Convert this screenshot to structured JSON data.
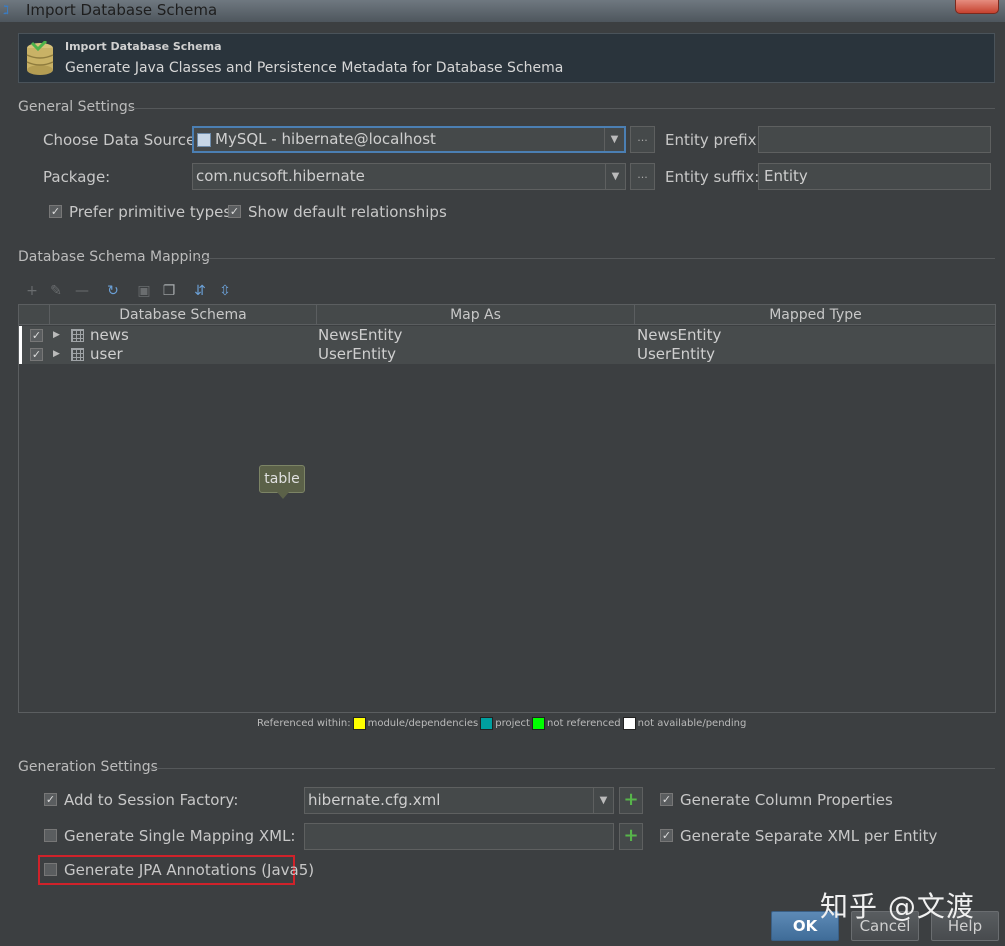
{
  "window": {
    "title": "Import Database Schema"
  },
  "header": {
    "title": "Import Database Schema",
    "subtitle": "Generate Java Classes and Persistence Metadata for Database Schema"
  },
  "general": {
    "section_label": "General Settings",
    "data_source_label": "Choose Data Source:",
    "data_source_value": "MySQL - hibernate@localhost",
    "package_label": "Package:",
    "package_value": "com.nucsoft.hibernate",
    "entity_prefix_label": "Entity prefix:",
    "entity_prefix_value": "",
    "entity_suffix_label": "Entity suffix:",
    "entity_suffix_value": "Entity",
    "browse_label": "...",
    "prefer_primitive_label": "Prefer primitive types",
    "prefer_primitive_checked": true,
    "show_relationships_label": "Show default relationships",
    "show_relationships_checked": true
  },
  "mapping": {
    "section_label": "Database Schema Mapping",
    "toolbar_icons": [
      "add-icon",
      "edit-icon",
      "remove-icon",
      "refresh-icon",
      "check-icon",
      "copy-icon",
      "expand-all-icon",
      "collapse-all-icon"
    ],
    "columns": [
      "Database Schema",
      "Map As",
      "Mapped Type"
    ],
    "rows": [
      {
        "schema": "news",
        "map_as": "NewsEntity",
        "mapped_type": "NewsEntity",
        "checked": true
      },
      {
        "schema": "user",
        "map_as": "UserEntity",
        "mapped_type": "UserEntity",
        "checked": true
      }
    ],
    "tooltip": "table"
  },
  "legend": {
    "prefix": "Referenced within:",
    "items": [
      {
        "label": "module/dependencies",
        "color": "#ffff00"
      },
      {
        "label": "project",
        "color": "#00a0a0"
      },
      {
        "label": "not referenced",
        "color": "#00ff00"
      },
      {
        "label": "not available/pending",
        "color": "#ffffff"
      }
    ]
  },
  "generation": {
    "section_label": "Generation Settings",
    "add_session_label": "Add to Session Factory:",
    "add_session_checked": true,
    "session_factory_value": "hibernate.cfg.xml",
    "single_mapping_label": "Generate Single Mapping XML:",
    "single_mapping_checked": false,
    "single_mapping_value": "",
    "jpa_label": "Generate JPA Annotations (Java5)",
    "jpa_checked": false,
    "column_props_label": "Generate Column Properties",
    "column_props_checked": true,
    "separate_xml_label": "Generate Separate XML per Entity",
    "separate_xml_checked": true
  },
  "buttons": {
    "ok": "OK",
    "cancel": "Cancel",
    "help": "Help"
  },
  "watermark": "知乎 @文渡"
}
